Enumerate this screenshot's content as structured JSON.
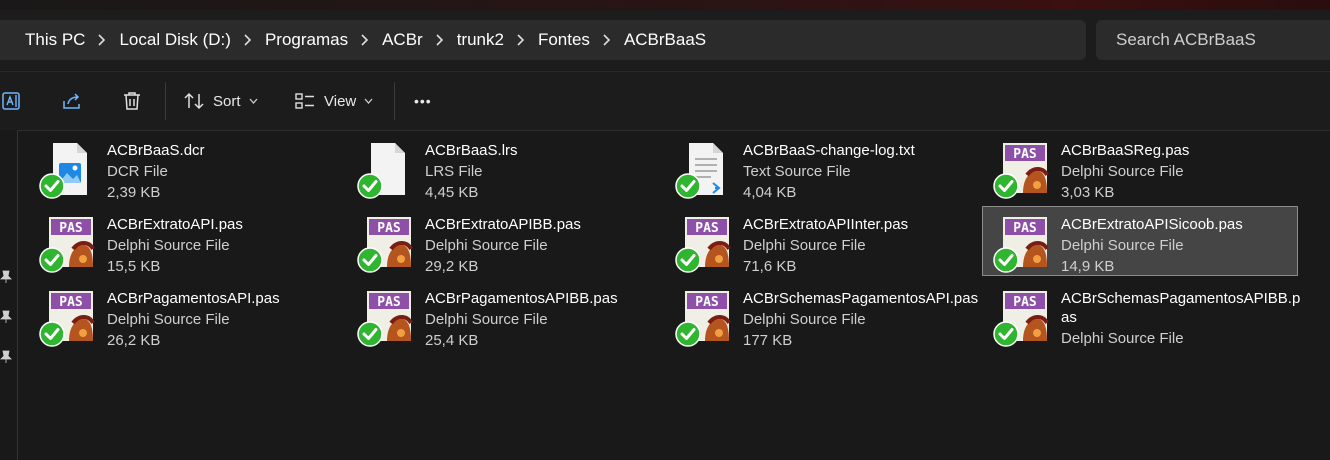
{
  "address_bar": {
    "breadcrumbs": [
      "This PC",
      "Local Disk (D:)",
      "Programas",
      "ACBr",
      "trunk2",
      "Fontes",
      "ACBrBaaS"
    ]
  },
  "search": {
    "placeholder": "Search ACBrBaaS"
  },
  "toolbar": {
    "sort_label": "Sort",
    "view_label": "View",
    "more_label": "•••",
    "icons": [
      "rename-icon",
      "share-icon",
      "delete-icon",
      "sort-icon",
      "view-icon"
    ]
  },
  "files": [
    {
      "name": "ACBrBaaS.dcr",
      "type": "DCR File",
      "size": "2,39 KB",
      "icon": "image-file-icon"
    },
    {
      "name": "ACBrBaaS.lrs",
      "type": "LRS File",
      "size": "4,45 KB",
      "icon": "blank-file-icon"
    },
    {
      "name": "ACBrBaaS-change-log.txt",
      "type": "Text Source File",
      "size": "4,04 KB",
      "icon": "text-file-icon"
    },
    {
      "name": "ACBrBaaSReg.pas",
      "type": "Delphi Source File",
      "size": "3,03 KB",
      "icon": "pas-file-icon"
    },
    {
      "name": "ACBrExtratoAPI.pas",
      "type": "Delphi Source File",
      "size": "15,5 KB",
      "icon": "pas-file-icon"
    },
    {
      "name": "ACBrExtratoAPIBB.pas",
      "type": "Delphi Source File",
      "size": "29,2 KB",
      "icon": "pas-file-icon"
    },
    {
      "name": "ACBrExtratoAPIInter.pas",
      "type": "Delphi Source File",
      "size": "71,6 KB",
      "icon": "pas-file-icon"
    },
    {
      "name": "ACBrExtratoAPISicoob.pas",
      "type": "Delphi Source File",
      "size": "14,9 KB",
      "icon": "pas-file-icon",
      "selected": true
    },
    {
      "name": "ACBrPagamentosAPI.pas",
      "type": "Delphi Source File",
      "size": "26,2 KB",
      "icon": "pas-file-icon"
    },
    {
      "name": "ACBrPagamentosAPIBB.pas",
      "type": "Delphi Source File",
      "size": "25,4 KB",
      "icon": "pas-file-icon"
    },
    {
      "name": "ACBrSchemasPagamentosAPI.pas",
      "type": "Delphi Source File",
      "size": "177 KB",
      "icon": "pas-file-icon"
    },
    {
      "name": "ACBrSchemasPagamentosAPIBB.pas",
      "type": "Delphi Source File",
      "size": "",
      "icon": "pas-file-icon"
    }
  ],
  "pas_badge_text": "PAS",
  "colors": {
    "window_bg": "#191919",
    "field_bg": "#2b2b2b",
    "selected_bg": "#454545",
    "sync_green": "#2fb52f",
    "pas_purple": "#8d4fa8"
  }
}
